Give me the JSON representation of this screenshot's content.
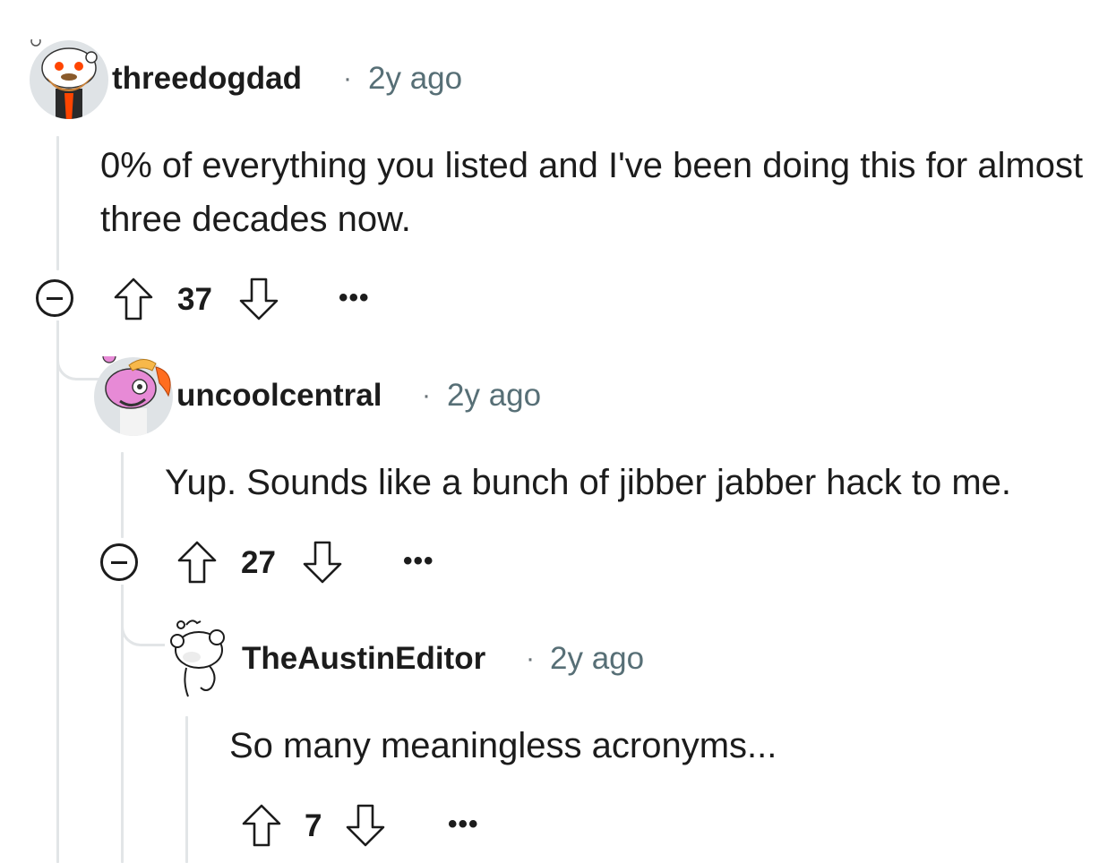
{
  "comments": [
    {
      "username": "threedogdad",
      "time": "2y ago",
      "separator": "·",
      "body": "0% of everything you listed and I've been doing this for almost three decades now.",
      "score": "37",
      "more": "•••"
    },
    {
      "username": "uncoolcentral",
      "time": "2y ago",
      "separator": "·",
      "body": "Yup. Sounds like a bunch of jibber jabber hack to me.",
      "score": "27",
      "more": "•••"
    },
    {
      "username": "TheAustinEditor",
      "time": "2y ago",
      "separator": "·",
      "body": "So many meaningless acronyms...",
      "score": "7",
      "more": "•••"
    }
  ],
  "icons": {
    "upvote": "upvote-arrow-icon",
    "downvote": "downvote-arrow-icon",
    "collapse": "collapse-thread-icon",
    "more": "more-options-icon"
  }
}
